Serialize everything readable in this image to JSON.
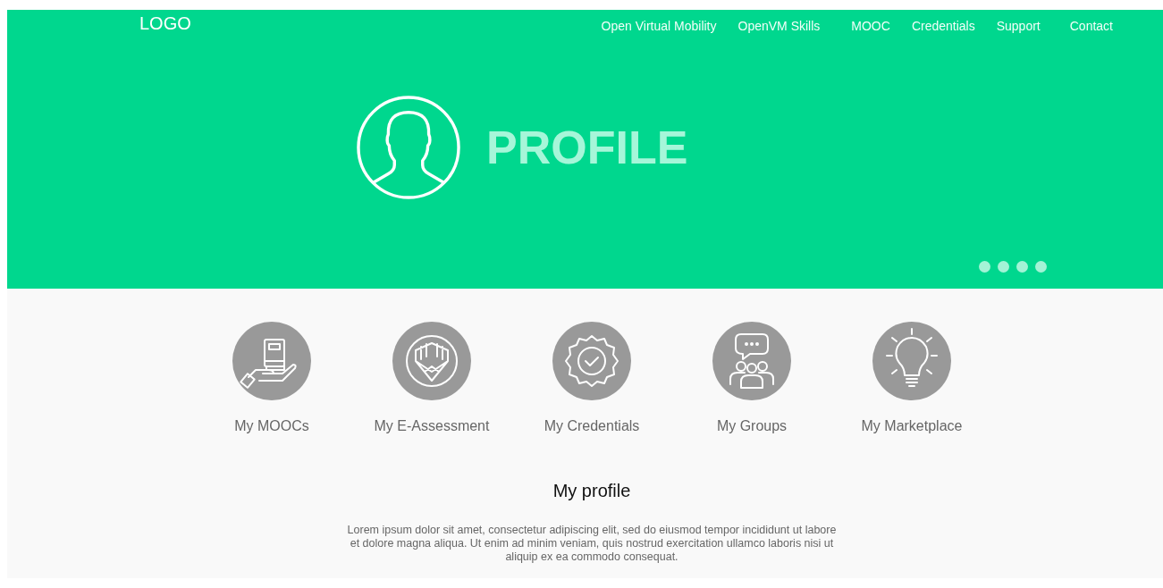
{
  "header": {
    "logo": "LOGO",
    "nav": [
      {
        "label": "Open Virtual Mobility"
      },
      {
        "label": "OpenVM Skills"
      },
      {
        "label": "MOOC"
      },
      {
        "label": "Credentials"
      },
      {
        "label": "Support"
      },
      {
        "label": "Contact"
      }
    ]
  },
  "hero": {
    "title": "PROFILE",
    "carousel_dots": [
      {
        "selected": false
      },
      {
        "selected": false
      },
      {
        "selected": false
      },
      {
        "selected": false
      }
    ]
  },
  "tiles": [
    {
      "kind": "book",
      "label": "My MOOCs"
    },
    {
      "kind": "pencil",
      "label": "My E-Assessment"
    },
    {
      "kind": "badge",
      "label": "My Credentials"
    },
    {
      "kind": "group",
      "label": "My Groups"
    },
    {
      "kind": "bulb",
      "label": "My Marketplace"
    }
  ],
  "section": {
    "title": "My profile",
    "text": "Lorem ipsum dolor sit amet, consectetur adipiscing elit, sed do eiusmod tempor incididunt ut labore et dolore magna aliqua. Ut enim ad minim veniam, quis nostrud exercitation ullamco laboris nisi ut aliquip ex ea commodo consequat."
  }
}
